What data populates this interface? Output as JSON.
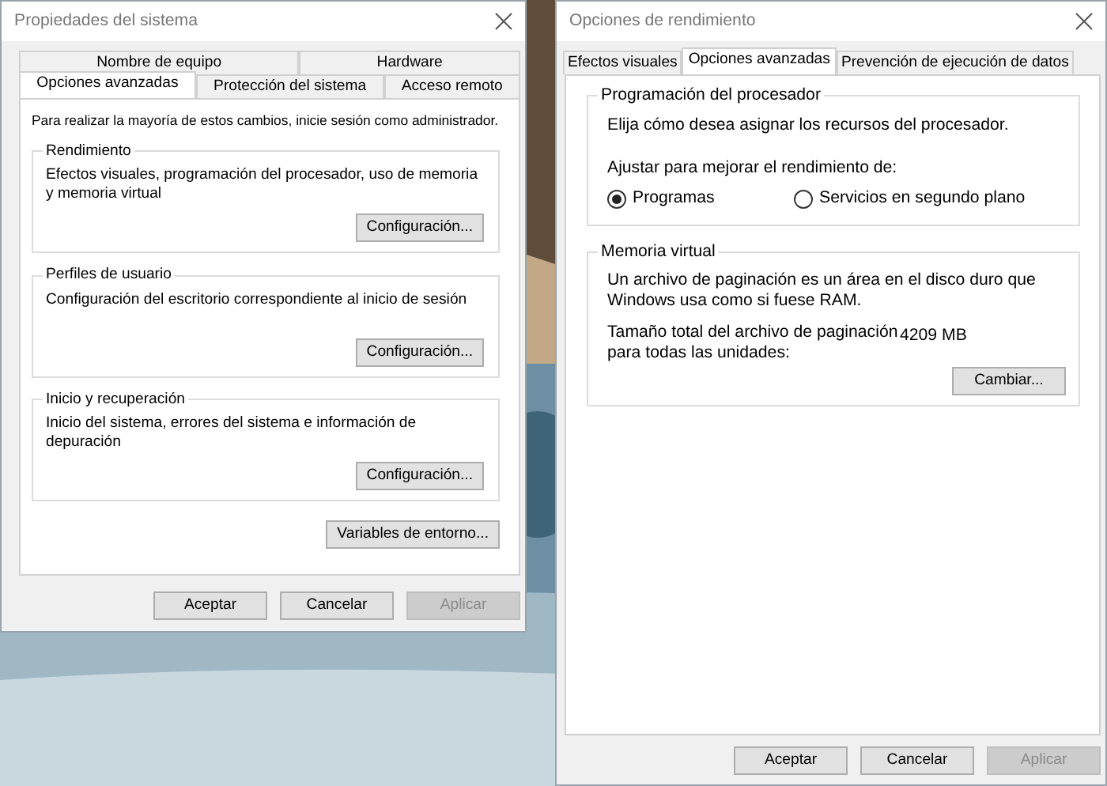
{
  "system_properties": {
    "title": "Propiedades del sistema",
    "tab_rows": [
      [
        {
          "label": "Nombre de equipo",
          "selected": false
        },
        {
          "label": "Hardware",
          "selected": false
        }
      ],
      [
        {
          "label": "Opciones avanzadas",
          "selected": true
        },
        {
          "label": "Protección del sistema",
          "selected": false
        },
        {
          "label": "Acceso remoto",
          "selected": false
        }
      ]
    ],
    "notice": "Para realizar la mayoría de estos cambios, inicie sesión como administrador.",
    "groups": [
      {
        "title": "Rendimiento",
        "text": "Efectos visuales, programación del procesador, uso de memoria y memoria virtual",
        "button": "Configuración..."
      },
      {
        "title": "Perfiles de usuario",
        "text": "Configuración del escritorio correspondiente al inicio de sesión",
        "button": "Configuración..."
      },
      {
        "title": "Inicio y recuperación",
        "text": "Inicio del sistema, errores del sistema e información de depuración",
        "button": "Configuración..."
      }
    ],
    "extra_button": "Variables de entorno...",
    "buttons": [
      {
        "label": "Aceptar",
        "disabled": false
      },
      {
        "label": "Cancelar",
        "disabled": false
      },
      {
        "label": "Aplicar",
        "disabled": true
      }
    ]
  },
  "performance_options": {
    "title": "Opciones de rendimiento",
    "tabs": [
      {
        "label": "Efectos visuales",
        "selected": false
      },
      {
        "label": "Opciones avanzadas",
        "selected": true
      },
      {
        "label": "Prevención de ejecución de datos",
        "selected": false
      }
    ],
    "processor_group": {
      "title": "Programación del procesador",
      "text": "Elija cómo desea asignar los recursos del procesador.",
      "prompt": "Ajustar para mejorar el rendimiento de:",
      "options": [
        {
          "label": "Programas",
          "selected": true
        },
        {
          "label": "Servicios en segundo plano",
          "selected": false
        }
      ]
    },
    "memory_group": {
      "title": "Memoria virtual",
      "text": "Un archivo de paginación es un área en el disco duro que Windows usa como si fuese RAM.",
      "size_label": "Tamaño total del archivo de paginación para todas las unidades:",
      "size_value": "4209 MB",
      "button": "Cambiar..."
    },
    "buttons": [
      {
        "label": "Aceptar",
        "disabled": false
      },
      {
        "label": "Cancelar",
        "disabled": false
      },
      {
        "label": "Aplicar",
        "disabled": true
      }
    ]
  }
}
